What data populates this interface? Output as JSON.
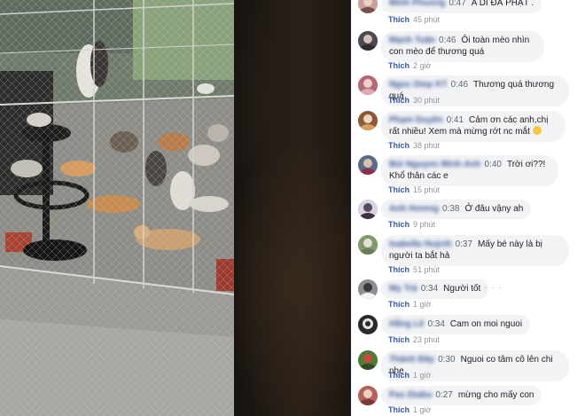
{
  "video": {
    "photo_alt": ""
  },
  "comments": [
    {
      "author": "Minh Phuong",
      "timestamp": "0:47",
      "text": "A DI ĐÀ PHẬT .",
      "like_label": "Thích",
      "ago": "45 phút",
      "avatar_color": "#c9a2a0"
    },
    {
      "author": "Mạnh Tuấn",
      "timestamp": "0:46",
      "text": "Ôi toàn mèo nhìn con mèo để thương quá",
      "like_label": "Thích",
      "ago": "2 giờ",
      "avatar_color": "#4a4a52"
    },
    {
      "author": "Ngoc Diep KT",
      "timestamp": "0:46",
      "text": "Thương quá thương quá",
      "like_label": "Thích",
      "ago": "30 phút",
      "avatar_color": "#b06a78"
    },
    {
      "author": "Phạm Duyên",
      "timestamp": "0:41",
      "text": "Cảm ơn các anh,chị rất nhiều! Xem mà mừng rớt nc mắt",
      "like_label": "Thích",
      "ago": "38 phút",
      "avatar_color": "#8a5a3a"
    },
    {
      "author": "Bùi Nguyen Minh Anh",
      "timestamp": "0:40",
      "text": "Trời ơi??! Khổ thân các e",
      "like_label": "Thích",
      "ago": "15 phút",
      "avatar_color": "#5c6b8a"
    },
    {
      "author": "Anh Hương",
      "timestamp": "0:38",
      "text": "Ở đâu vậny ah",
      "like_label": "Thích",
      "ago": "9 phút",
      "avatar_color": "#d8d4e6"
    },
    {
      "author": "Isabella Huỳnh",
      "timestamp": "0:37",
      "text": "Mấy bé này là bị người ta bắt hả",
      "like_label": "Thích",
      "ago": "51 phút",
      "avatar_color": "#7f9a6c"
    },
    {
      "author": "My Trà",
      "timestamp": "0:34",
      "text": "Người tốt",
      "like_label": "Thích",
      "ago": "1 giờ",
      "avatar_color": "#8c8e94"
    },
    {
      "author": "Hằng Lê",
      "timestamp": "0:34",
      "text": "Cam on moi nguoi",
      "like_label": "Thích",
      "ago": "23 phút",
      "avatar_color": "#2a2a2e"
    },
    {
      "author": "Thành Đây",
      "timestamp": "0:30",
      "text": "Nguoi co tâm cô lên chi nhe",
      "like_label": "Thích",
      "ago": "1 giờ",
      "avatar_color": "#4f7a3c"
    },
    {
      "author": "Pas Diabu",
      "timestamp": "0:27",
      "text": "mừng cho mấy con",
      "like_label": "Thích",
      "ago": "1 giờ",
      "avatar_color": "#b5625a"
    }
  ],
  "menu_dots": "· · ·"
}
